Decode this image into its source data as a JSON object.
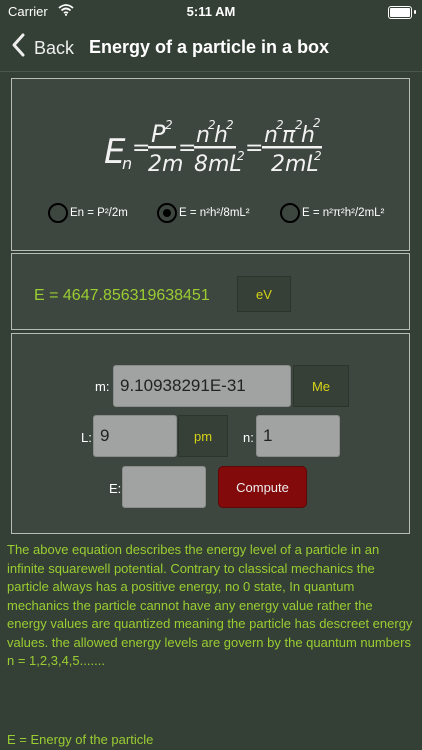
{
  "status_bar": {
    "carrier": "Carrier",
    "time": "5:11 AM"
  },
  "nav": {
    "back_label": "Back",
    "title": "Energy of a particle in a box"
  },
  "formula": {
    "radio_options": [
      {
        "label": "En = P²/2m",
        "selected": false
      },
      {
        "label": "E = n²h²/8mL²",
        "selected": true
      },
      {
        "label": "E = n²π²h²/2mL²",
        "selected": false
      }
    ]
  },
  "result": {
    "value": "E = 4647.856319638451",
    "unit": "eV"
  },
  "inputs": {
    "mass": {
      "label": "m:",
      "value": "9.10938291E-31",
      "unit": "Me"
    },
    "length": {
      "label": "L:",
      "value": "9",
      "unit": "pm"
    },
    "quantum_number": {
      "label": "n:",
      "value": "1"
    },
    "energy": {
      "label": "E:",
      "value": ""
    },
    "compute_label": "Compute"
  },
  "description": "The above equation describes the energy level of a particle in an infinite squarewell potential. Contrary to classical mechanics the particle always has a positive energy, no 0 state,  In quantum mechanics the particle cannot have any energy value rather the energy values are quantized meaning the particle has descreet energy values. the allowed energy levels are govern by the quantum numbers n = 1,2,3,4,5.......",
  "definition": "E = Energy of the particle",
  "colors": {
    "background": "#344036",
    "panel": "#3e473f",
    "accent_text": "#9acd32",
    "unit_text": "#d7d317",
    "compute_button": "#820a0b"
  }
}
